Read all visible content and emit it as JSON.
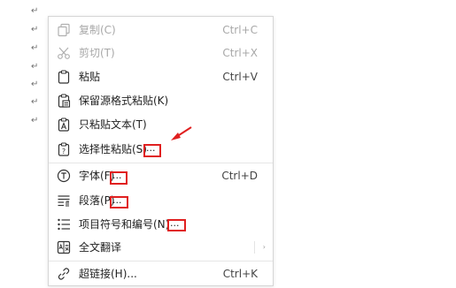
{
  "context_menu": {
    "items": [
      {
        "label": "复制(C)",
        "shortcut": "Ctrl+C",
        "icon": "copy-icon",
        "disabled": true
      },
      {
        "label": "剪切(T)",
        "shortcut": "Ctrl+X",
        "icon": "scissors-icon",
        "disabled": true
      },
      {
        "label": "粘贴",
        "shortcut": "Ctrl+V",
        "icon": "clipboard-icon",
        "disabled": false
      },
      {
        "label": "保留源格式粘贴(K)",
        "shortcut": "",
        "icon": "paste-keep-format-icon",
        "disabled": false
      },
      {
        "label": "只粘贴文本(T)",
        "shortcut": "",
        "icon": "paste-text-only-icon",
        "disabled": false
      },
      {
        "label": "选择性粘贴(S)",
        "suffix": "...",
        "shortcut": "",
        "icon": "paste-special-icon",
        "disabled": false
      },
      {
        "label": "字体(F)",
        "suffix": "...",
        "shortcut": "Ctrl+D",
        "icon": "font-icon",
        "disabled": false
      },
      {
        "label": "段落(P)",
        "suffix": "...",
        "shortcut": "",
        "icon": "paragraph-icon",
        "disabled": false
      },
      {
        "label": "项目符号和编号(N)",
        "suffix": "...",
        "shortcut": "",
        "icon": "bullet-list-icon",
        "disabled": false
      },
      {
        "label": "全文翻译",
        "shortcut": "",
        "icon": "translate-icon",
        "disabled": false,
        "submenu": true
      },
      {
        "label": "超链接(H)...",
        "shortcut": "Ctrl+K",
        "icon": "link-icon",
        "disabled": false
      }
    ],
    "submenu_arrow": "›"
  },
  "document": {
    "paragraph_mark": "↵"
  },
  "colors": {
    "annotation_red": "#e02020",
    "disabled_text": "#a8a8a8"
  }
}
